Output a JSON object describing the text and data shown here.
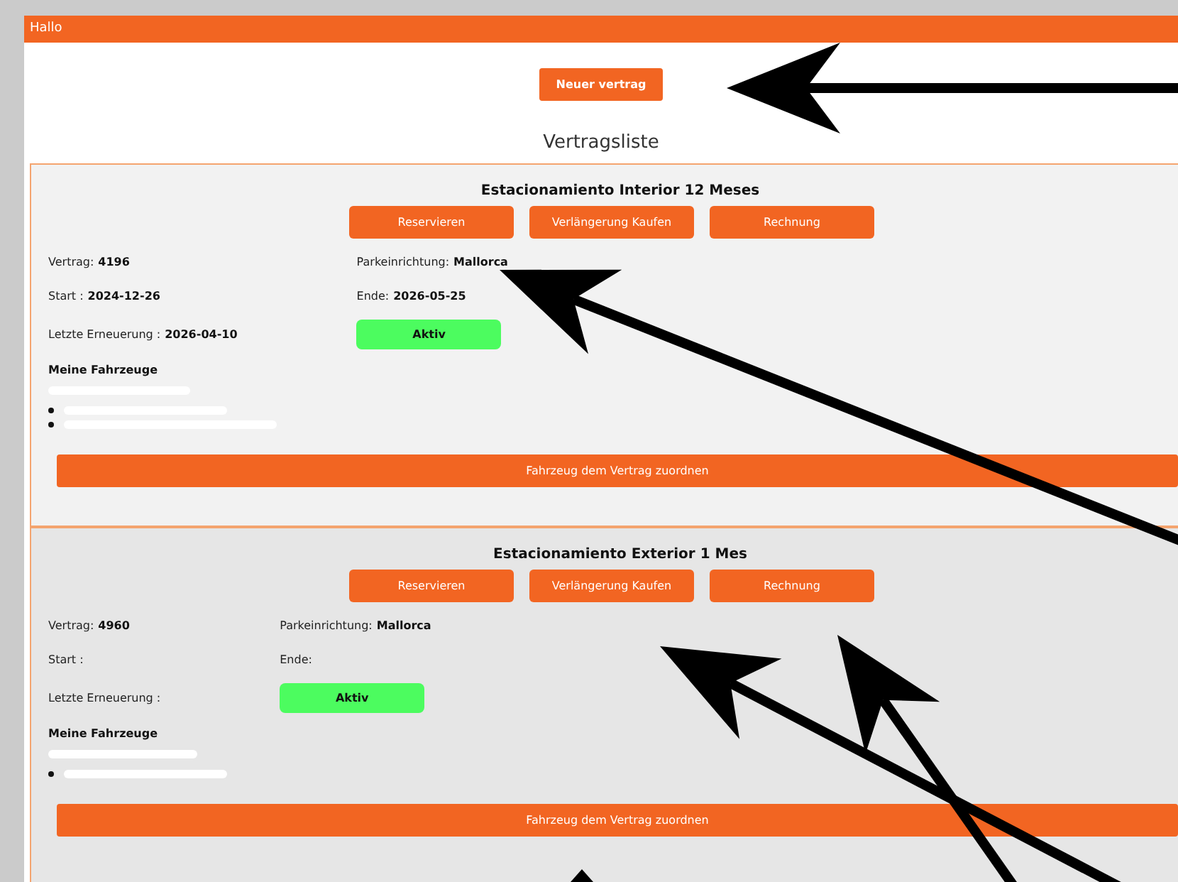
{
  "header": {
    "title": "Hallo"
  },
  "new_button": "Neuer vertrag",
  "list_title": "Vertragsliste",
  "contracts": [
    {
      "name": "Estacionamiento Interior 12 Meses",
      "actions": [
        "Reservieren",
        "Verlängerung Kaufen",
        "Rechnung"
      ],
      "contract_label": "Vertrag:",
      "contract_no": "4196",
      "facility_label": "Parkeinrichtung:",
      "facility": "Mallorca",
      "start_label": "Start :",
      "start": "2024-12-26",
      "end_label": "Ende:",
      "end": "2026-05-25",
      "renewal_label": "Letzte Erneuerung :",
      "renewal": "2026-04-10",
      "status": {
        "kind": "active",
        "label": "Aktiv"
      },
      "vehicles_title": "Meine Fahrzeuge",
      "vehicle_lines": [
        {
          "kind": "redacted"
        }
      ],
      "vehicles": [
        {
          "kind": "redacted"
        },
        {
          "kind": "redacted"
        }
      ],
      "assign_button": "Fahrzeug dem Vertrag zuordnen"
    },
    {
      "name": "Estacionamiento Exterior 1 Mes",
      "actions": [
        "Reservieren",
        "Verlängerung Kaufen",
        "Rechnung"
      ],
      "contract_label": "Vertrag:",
      "contract_no": "4960",
      "facility_label": "Parkeinrichtung:",
      "facility": "Mallorca",
      "start_label": "Start :",
      "end_label": "Ende:",
      "renewal_label": "Letzte Erneuerung :",
      "status": {
        "kind": "active",
        "label": "Aktiv"
      },
      "vehicles_title": "Meine Fahrzeuge",
      "vehicle_lines": [
        {
          "kind": "redacted"
        }
      ],
      "vehicles": [
        {
          "kind": "redacted"
        }
      ],
      "assign_button": "Fahrzeug dem Vertrag zuordnen"
    }
  ]
}
